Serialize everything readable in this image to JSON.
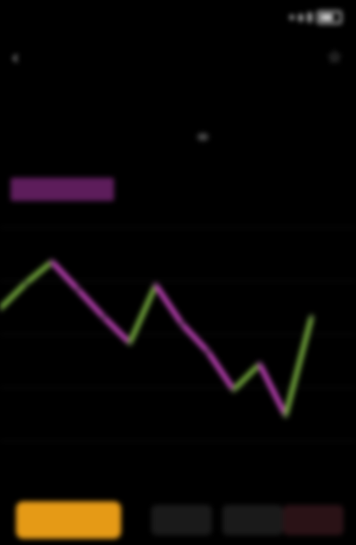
{
  "status_bar": {
    "time": ""
  },
  "header": {
    "pair_title": "",
    "back_icon": "chevron-left-icon",
    "star_icon": "star-icon"
  },
  "price": {
    "last": "",
    "fiat": "",
    "change": ""
  },
  "stats": [
    {
      "label": "",
      "value": ""
    },
    {
      "label": "",
      "value": ""
    },
    {
      "label": "",
      "value": ""
    },
    {
      "label": "",
      "value": ""
    }
  ],
  "intervals": [
    "",
    "",
    "",
    ""
  ],
  "indicator_badge": "",
  "chart_data": {
    "type": "line",
    "x": [
      0,
      1,
      2,
      3,
      4,
      5,
      6,
      7,
      8,
      9,
      10,
      11,
      12
    ],
    "series": [
      {
        "values": [
          62,
          74,
          84,
          71,
          58,
          46,
          73,
          55,
          42,
          24,
          36,
          12,
          58
        ]
      }
    ],
    "ylim": [
      0,
      100
    ],
    "grid": true,
    "colors": {
      "down": "#b83fb0",
      "up": "#6fa33a"
    }
  },
  "actions": {
    "buy_label": "",
    "nav_1": "",
    "nav_2": "",
    "nav_3": ""
  },
  "colors": {
    "background": "#000000",
    "accent": "#e59a16",
    "badge": "#5d1d5b"
  }
}
